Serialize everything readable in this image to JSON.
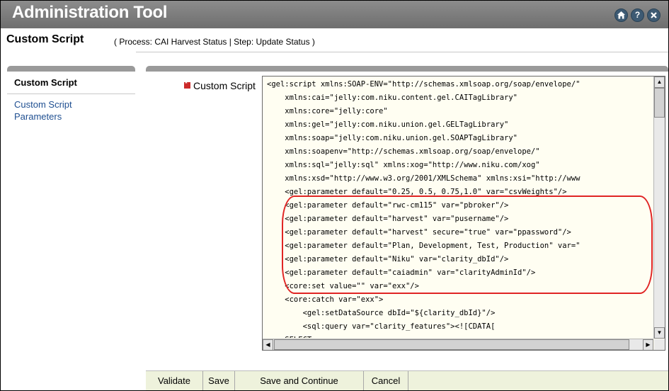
{
  "app": {
    "title": "Administration Tool"
  },
  "header_icons": [
    "home-icon",
    "help-icon",
    "close-icon"
  ],
  "page": {
    "title": "Custom Script",
    "context": "( Process: CAI Harvest Status | Step: Update Status )"
  },
  "nav": {
    "items": [
      {
        "label": "Custom Script",
        "active": true
      },
      {
        "label": "Custom Script Parameters",
        "active": false
      }
    ]
  },
  "field": {
    "label": "Custom Script",
    "required": true
  },
  "script_lines": [
    "<gel:script xmlns:SOAP-ENV=\"http://schemas.xmlsoap.org/soap/envelope/\"",
    "    xmlns:cai=\"jelly:com.niku.content.gel.CAITagLibrary\"",
    "    xmlns:core=\"jelly:core\"",
    "    xmlns:gel=\"jelly:com.niku.union.gel.GELTagLibrary\"",
    "    xmlns:soap=\"jelly:com.niku.union.gel.SOAPTagLibrary\"",
    "    xmlns:soapenv=\"http://schemas.xmlsoap.org/soap/envelope/\"",
    "    xmlns:sql=\"jelly:sql\" xmlns:xog=\"http://www.niku.com/xog\"",
    "    xmlns:xsd=\"http://www.w3.org/2001/XMLSchema\" xmlns:xsi=\"http://www",
    "    <gel:parameter default=\"0.25, 0.5, 0.75,1.0\" var=\"csvWeights\"/>",
    "    <gel:parameter default=\"rwc-cm115\" var=\"pbroker\"/>",
    "    <gel:parameter default=\"harvest\" var=\"pusername\"/>",
    "    <gel:parameter default=\"harvest\" secure=\"true\" var=\"ppassword\"/>",
    "    <gel:parameter default=\"Plan, Development, Test, Production\" var=\"",
    "    <gel:parameter default=\"Niku\" var=\"clarity_dbId\"/>",
    "    <gel:parameter default=\"caiadmin\" var=\"clarityAdminId\"/>",
    "    <core:set value=\"\" var=\"exx\"/>",
    "    <core:catch var=\"exx\">",
    "        <gel:setDataSource dbId=\"${clarity_dbId}\"/>",
    "        <sql:query var=\"clarity_features\"><![CDATA[",
    "    SELECT"
  ],
  "buttons": {
    "validate": "Validate",
    "save": "Save",
    "save_continue": "Save and Continue",
    "cancel": "Cancel"
  },
  "colors": {
    "title_bar": "#7c7c7c",
    "nav_link": "#1f4f91",
    "required": "#cc2a2a",
    "highlight": "#e02424",
    "footer_bg": "#eef2dc"
  }
}
